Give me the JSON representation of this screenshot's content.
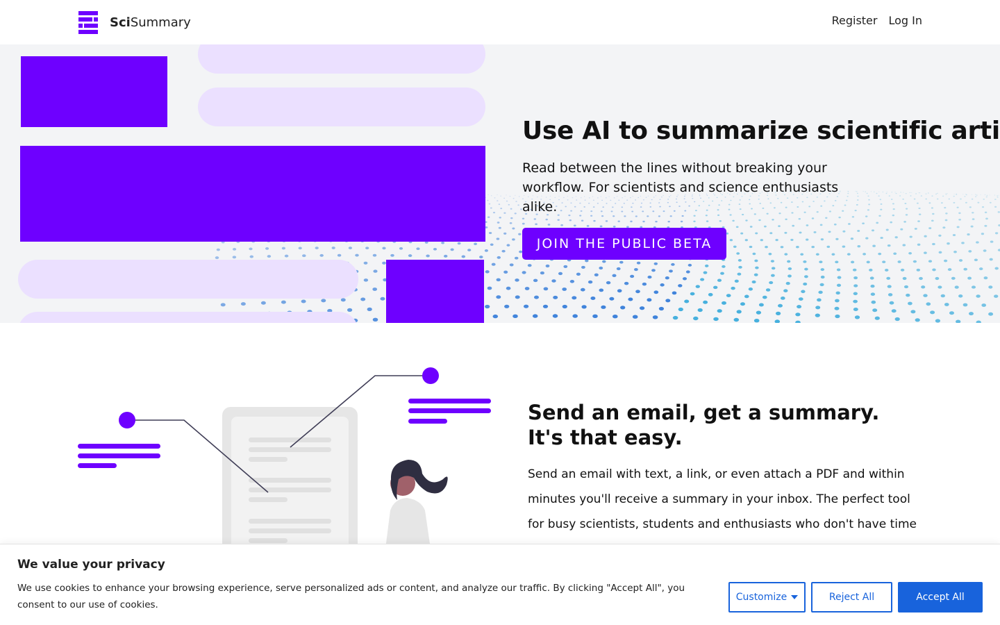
{
  "header": {
    "logo_bold": "Sci",
    "logo_rest": "Summary",
    "nav": {
      "register": "Register",
      "login": "Log In"
    }
  },
  "hero": {
    "title": "Use AI to summarize scientific articles",
    "subtitle": "Read between the lines without breaking your workflow. For scientists and science enthusiasts alike.",
    "cta_label": "Join the public beta"
  },
  "feature": {
    "title": "Send an email, get a summary. It's that easy.",
    "text": "Send an email with text, a link, or even attach a PDF and within minutes you'll receive a summary in your inbox. The perfect tool for busy scientists, students and enthusiasts who don't have time"
  },
  "cookie": {
    "title": "We value your privacy",
    "text": "We use cookies to enhance your browsing experience, serve personalized ads or content, and analyze our traffic. By clicking \"Accept All\", you consent to our use of cookies.",
    "customize": "Customize",
    "reject": "Reject All",
    "accept": "Accept All"
  },
  "colors": {
    "brand": "#6e00ff",
    "brand_light": "#ebe0ff",
    "cookie_accent": "#1863dc",
    "hero_bg": "#f3f4f6"
  },
  "icons": [
    "scisummary-logo-icon",
    "caret-down-icon"
  ]
}
